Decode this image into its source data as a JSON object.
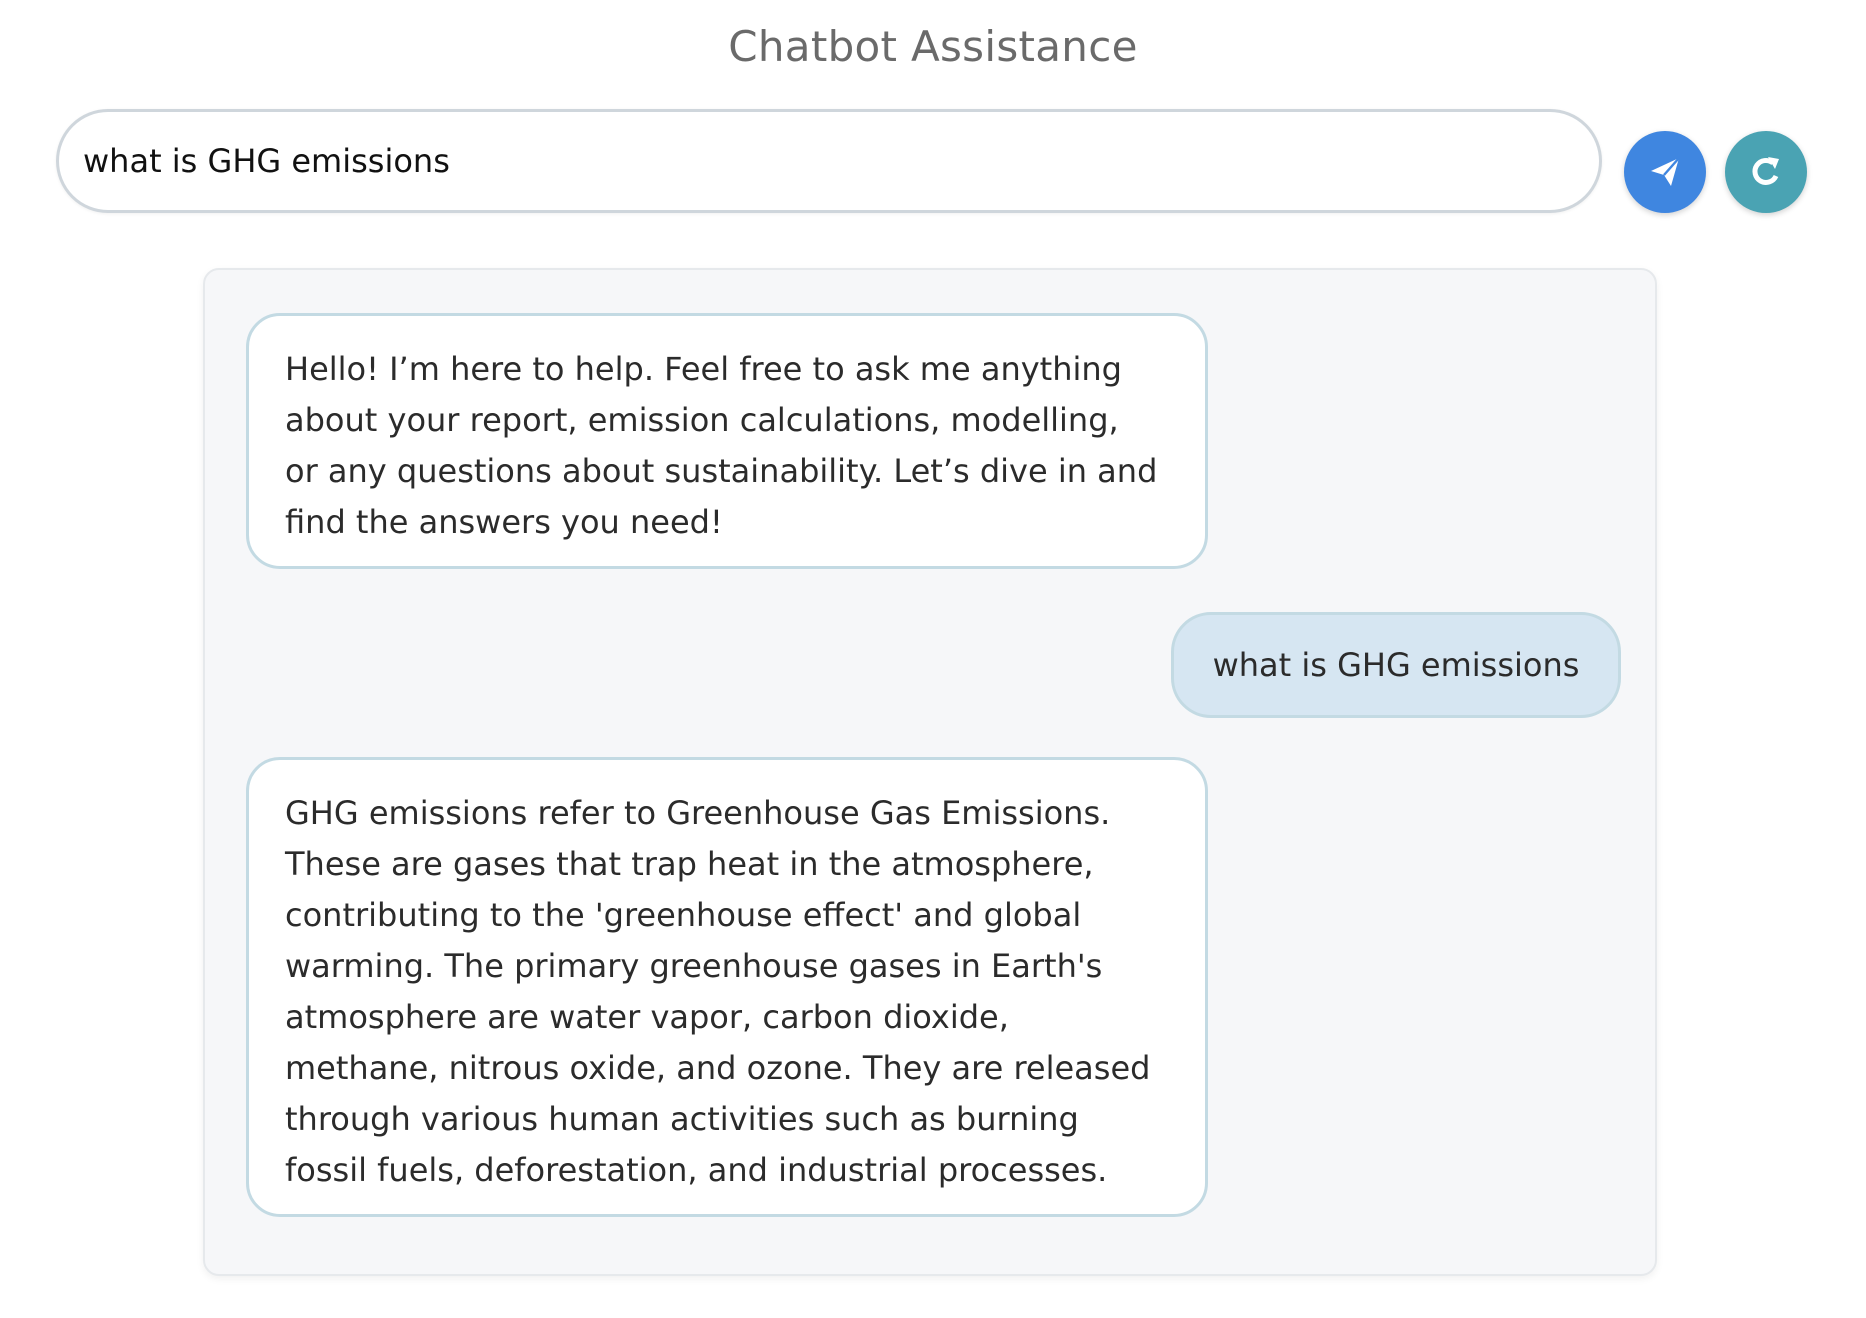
{
  "header": {
    "title": "Chatbot Assistance"
  },
  "input": {
    "value": "what is GHG emissions",
    "placeholder": ""
  },
  "buttons": {
    "send_icon": "paper-plane-icon",
    "refresh_icon": "refresh-icon"
  },
  "colors": {
    "send_button": "#3f86e0",
    "refresh_button": "#4aa3b3",
    "user_bubble": "#d6e6f2",
    "bubble_border": "#c3dae3",
    "panel_background": "#f6f7f9"
  },
  "messages": [
    {
      "role": "bot",
      "text": "Hello! I’m here to help. Feel free to ask me anything\nabout your report, emission calculations, modelling,\nor any questions about sustainability. Let’s dive in and\nfind the answers you need!"
    },
    {
      "role": "user",
      "text": "what is GHG emissions"
    },
    {
      "role": "bot",
      "text": "GHG emissions refer to Greenhouse Gas Emissions.\nThese are gases that trap heat in the atmosphere,\ncontributing to the 'greenhouse effect' and global\nwarming. The primary greenhouse gases in Earth's\natmosphere are water vapor, carbon dioxide,\nmethane, nitrous oxide, and ozone. They are released\nthrough various human activities such as burning\nfossil fuels, deforestation, and industrial processes."
    }
  ]
}
